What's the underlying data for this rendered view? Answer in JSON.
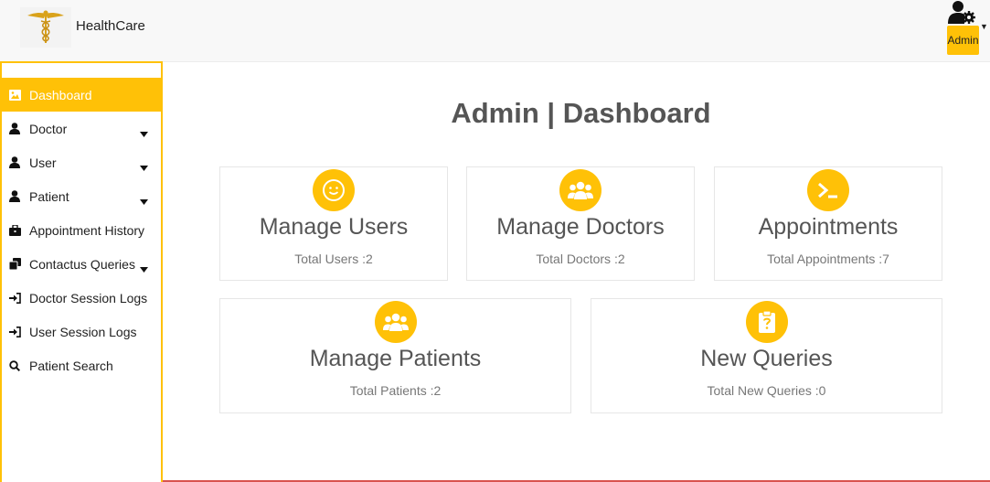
{
  "header": {
    "brand": "HealthCare",
    "admin_label": "Admin",
    "accent": "#ffc107"
  },
  "sidebar": {
    "items": [
      {
        "label": "Dashboard",
        "icon": "image-icon",
        "active": true,
        "has_caret": false
      },
      {
        "label": "Doctor",
        "icon": "user-icon",
        "has_caret": true
      },
      {
        "label": "User",
        "icon": "user-icon",
        "has_caret": true
      },
      {
        "label": "Patient",
        "icon": "user-icon",
        "has_caret": true
      },
      {
        "label": "Appointment History",
        "icon": "briefcase-icon",
        "has_caret": false
      },
      {
        "label": "Contactus Queries",
        "icon": "copy-icon",
        "has_caret": true
      },
      {
        "label": "Doctor Session Logs",
        "icon": "sign-in-icon",
        "has_caret": false
      },
      {
        "label": "User Session Logs",
        "icon": "sign-in-icon",
        "has_caret": false
      },
      {
        "label": "Patient Search",
        "icon": "search-icon",
        "has_caret": false
      }
    ]
  },
  "main": {
    "title": "Admin | Dashboard",
    "cards": [
      {
        "title": "Manage Users",
        "subtitle": "Total Users :2",
        "icon": "smile-icon"
      },
      {
        "title": "Manage Doctors",
        "subtitle": "Total Doctors :2",
        "icon": "users-icon"
      },
      {
        "title": "Appointments",
        "subtitle": "Total Appointments :7",
        "icon": "terminal-icon"
      },
      {
        "title": "Manage Patients",
        "subtitle": "Total Patients :2",
        "icon": "users-icon"
      },
      {
        "title": "New Queries",
        "subtitle": "Total New Queries :0",
        "icon": "clipboard-question-icon"
      }
    ]
  }
}
